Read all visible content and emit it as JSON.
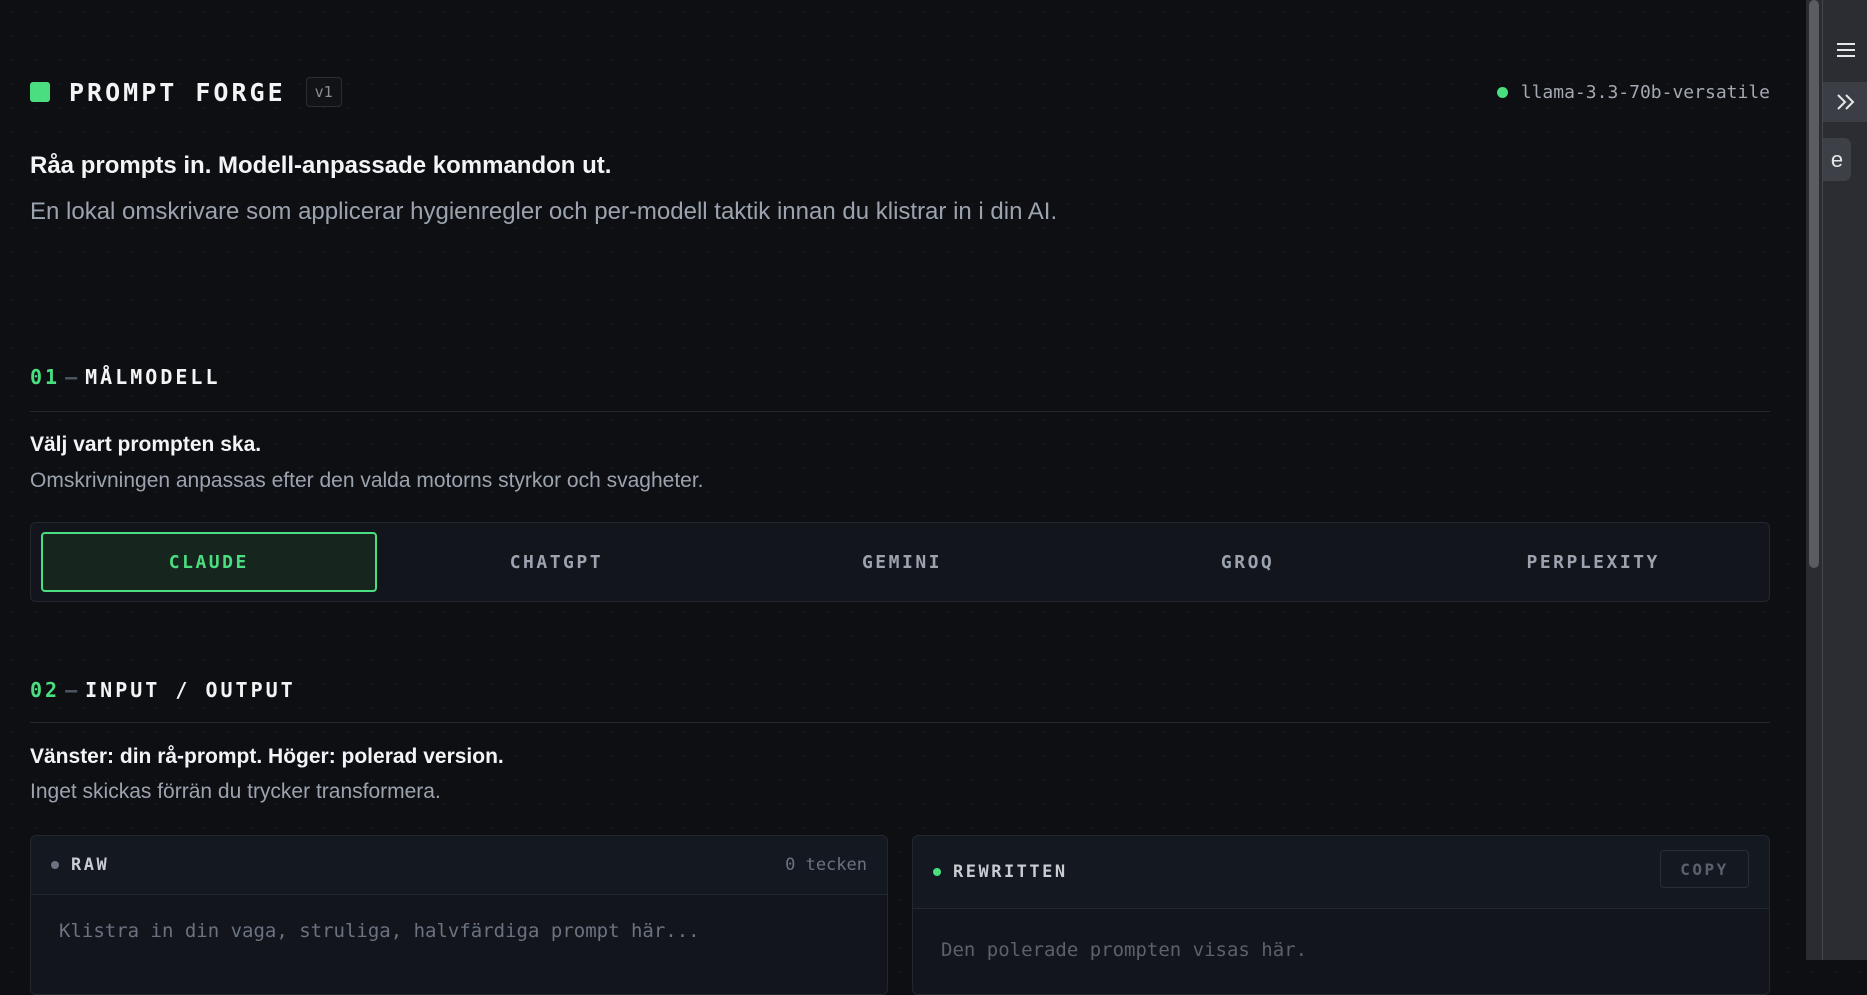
{
  "header": {
    "title": "PROMPT FORGE",
    "version": "v1",
    "model": "llama-3.3-70b-versatile"
  },
  "hero": {
    "tagline": "Råa prompts in. Modell-anpassade kommandon ut.",
    "description": "En lokal omskrivare som applicerar hygienregler och per-modell taktik innan du klistrar in i din AI."
  },
  "section1": {
    "number": "01",
    "dash": "—",
    "title": "MÅLMODELL",
    "lead": "Välj vart prompten ska.",
    "sub": "Omskrivningen anpassas efter den valda motorns styrkor och svagheter.",
    "models": [
      {
        "label": "CLAUDE",
        "selected": true
      },
      {
        "label": "CHATGPT",
        "selected": false
      },
      {
        "label": "GEMINI",
        "selected": false
      },
      {
        "label": "GROQ",
        "selected": false
      },
      {
        "label": "PERPLEXITY",
        "selected": false
      }
    ]
  },
  "section2": {
    "number": "02",
    "dash": "—",
    "title": "INPUT / OUTPUT",
    "lead": "Vänster: din rå-prompt. Höger: polerad version.",
    "sub": "Inget skickas förrän du trycker transformera."
  },
  "raw_panel": {
    "title": "RAW",
    "count": "0 tecken",
    "placeholder": "Klistra in din vaga, struliga, halvfärdiga prompt här...",
    "value": ""
  },
  "output_panel": {
    "title": "REWRITTEN",
    "copy_label": "COPY",
    "placeholder": "Den polerade prompten visas här."
  },
  "dock": {
    "menu_icon": "hamburger-menu-icon",
    "collapse_icon": "double-chevron-right-icon",
    "tab_letter": "e"
  },
  "colors": {
    "accent": "#4ade80",
    "background": "#0d0f13",
    "panel": "#12151b",
    "border": "#23272f"
  }
}
